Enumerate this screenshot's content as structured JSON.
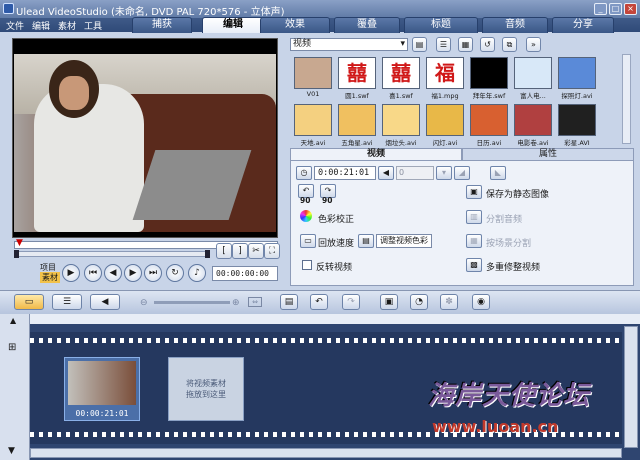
{
  "window": {
    "title": "Ulead VideoStudio (未命名, DVD PAL 720*576 - 立体声)"
  },
  "menu": [
    "文件",
    "编辑",
    "素材",
    "工具"
  ],
  "tabs": [
    {
      "label": "捕获",
      "active": false
    },
    {
      "label": "编辑",
      "active": true
    },
    {
      "label": "效果",
      "active": false
    },
    {
      "label": "覆叠",
      "active": false
    },
    {
      "label": "标题",
      "active": false
    },
    {
      "label": "音频",
      "active": false
    },
    {
      "label": "分享",
      "active": false
    }
  ],
  "player": {
    "mode_label1": "项目",
    "mode_label2": "素材",
    "timecode": "00:00:00:00",
    "trim_in": "[",
    "trim_out": "]"
  },
  "library": {
    "category": "视频",
    "thumbs": [
      {
        "label": "V01",
        "color": "#c8a890"
      },
      {
        "label": "圆1.swf",
        "color": "#ffffff",
        "text": "囍",
        "text_color": "#d01818"
      },
      {
        "label": "喜1.swf",
        "color": "#ffffff",
        "text": "囍",
        "text_color": "#d01818"
      },
      {
        "label": "福1.mpg",
        "color": "#ffffff",
        "text": "福",
        "text_color": "#d01818"
      },
      {
        "label": "拜年年.swf",
        "color": "#000000"
      },
      {
        "label": "富人电...",
        "color": "#d8e8f8"
      },
      {
        "label": "探照灯.avi",
        "color": "#5a8ad8"
      },
      {
        "label": "天地.avi",
        "color": "#f4d080"
      },
      {
        "label": "五角星.avi",
        "color": "#f0c060"
      },
      {
        "label": "烟垃头.avi",
        "color": "#f8d888"
      },
      {
        "label": "闪灯.avi",
        "color": "#e8b848"
      },
      {
        "label": "日历.avi",
        "color": "#d86030"
      },
      {
        "label": "电影卷.avi",
        "color": "#b04040"
      },
      {
        "label": "彩星.AVI",
        "color": "#202020"
      }
    ]
  },
  "options": {
    "tab_video": "视频",
    "tab_attr": "属性",
    "duration": "0:00:21:01",
    "volume": "0",
    "rotate_left": "90",
    "rotate_right": "90",
    "color_correct": "色彩校正",
    "playback_speed": "回放速度",
    "adjust_color": "调整视频色彩",
    "reverse": "反转视频",
    "save_still": "保存为静态图像",
    "split_audio": "分割音频",
    "split_scene": "按场景分割",
    "multi_trim": "多重修整视频"
  },
  "timeline": {
    "clip_timecode": "00:00:21:01",
    "drop_hint_line1": "将视频素材",
    "drop_hint_line2": "拖放到这里"
  },
  "watermark": {
    "text": "海岸天使论坛",
    "url": "www.luoan.cn"
  }
}
